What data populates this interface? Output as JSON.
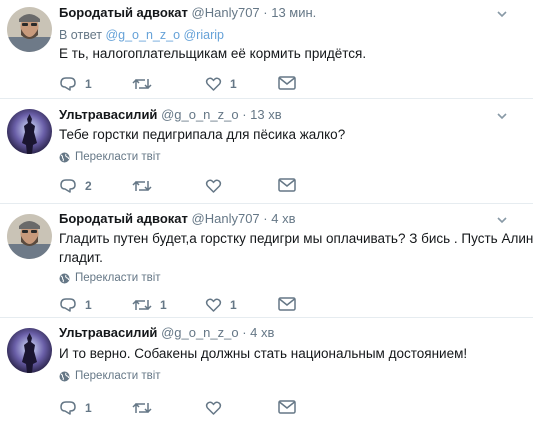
{
  "tweets": [
    {
      "name": "Бородатый адвокат",
      "handle": "@Hanly707",
      "time": "· 13 мин.",
      "reply_prefix": "В ответ",
      "reply_mentions": "@g_o_n_z_o @riarip",
      "text": "Е    ть, налогоплательщикам её кормить придётся.",
      "reply_count": "1",
      "retweet_count": "",
      "like_count": "1",
      "avatar": "bearded-man"
    },
    {
      "name": "Ультравасилий",
      "handle": "@g_o_n_z_o",
      "time": "· 13 хв",
      "text": "Тебе горстки педигрипала для пёсика жалко?",
      "translate": "Перекласти твіт",
      "reply_count": "2",
      "retweet_count": "",
      "like_count": "",
      "avatar": "statue-silhouette"
    },
    {
      "name": "Бородатый адвокат",
      "handle": "@Hanly707",
      "time": "· 4 хв",
      "text_line1": "Гладить путен будет,а горстку педигри мы оплачивать? З    бись . Пусть Алину",
      "text_line2": "гладит.",
      "translate": "Перекласти твіт",
      "reply_count": "1",
      "retweet_count": "1",
      "like_count": "1",
      "avatar": "bearded-man"
    },
    {
      "name": "Ультравасилий",
      "handle": "@g_o_n_z_o",
      "time": "· 4 хв",
      "text": "И то верно. Собакены должны стать национальным достоянием!",
      "translate": "Перекласти твіт",
      "reply_count": "1",
      "retweet_count": "",
      "like_count": "",
      "avatar": "statue-silhouette"
    }
  ],
  "colors": {
    "icon_gray": "#657786",
    "link_blue": "#66a2d8",
    "divider": "#e6ecf0"
  }
}
